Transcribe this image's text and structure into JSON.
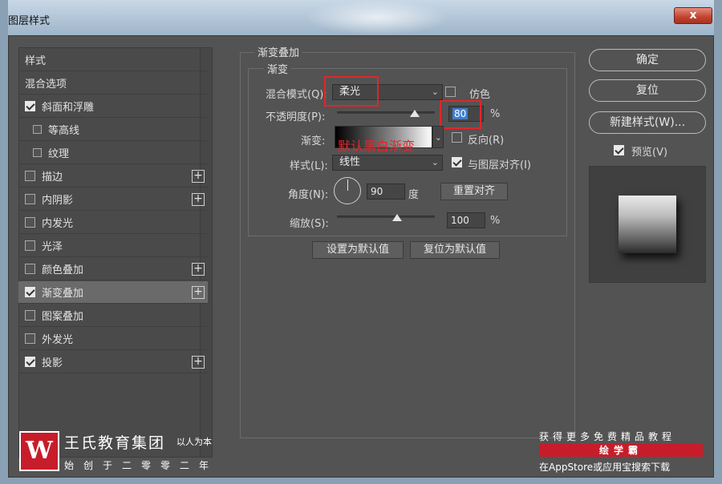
{
  "window": {
    "title": "图层样式",
    "close": "x"
  },
  "left_panel": {
    "items": [
      {
        "label": "样式",
        "checkbox": false,
        "checked": false,
        "plus": false,
        "indent": false,
        "selected": false
      },
      {
        "label": "混合选项",
        "checkbox": false,
        "checked": false,
        "plus": false,
        "indent": false,
        "selected": false
      },
      {
        "label": "斜面和浮雕",
        "checkbox": true,
        "checked": true,
        "plus": false,
        "indent": false,
        "selected": false
      },
      {
        "label": "等高线",
        "checkbox": true,
        "checked": false,
        "plus": false,
        "indent": true,
        "selected": false
      },
      {
        "label": "纹理",
        "checkbox": true,
        "checked": false,
        "plus": false,
        "indent": true,
        "selected": false
      },
      {
        "label": "描边",
        "checkbox": true,
        "checked": false,
        "plus": true,
        "indent": false,
        "selected": false
      },
      {
        "label": "内阴影",
        "checkbox": true,
        "checked": false,
        "plus": true,
        "indent": false,
        "selected": false
      },
      {
        "label": "内发光",
        "checkbox": true,
        "checked": false,
        "plus": false,
        "indent": false,
        "selected": false
      },
      {
        "label": "光泽",
        "checkbox": true,
        "checked": false,
        "plus": false,
        "indent": false,
        "selected": false
      },
      {
        "label": "颜色叠加",
        "checkbox": true,
        "checked": false,
        "plus": true,
        "indent": false,
        "selected": false
      },
      {
        "label": "渐变叠加",
        "checkbox": true,
        "checked": true,
        "plus": true,
        "indent": false,
        "selected": true
      },
      {
        "label": "图案叠加",
        "checkbox": true,
        "checked": false,
        "plus": false,
        "indent": false,
        "selected": false
      },
      {
        "label": "外发光",
        "checkbox": true,
        "checked": false,
        "plus": false,
        "indent": false,
        "selected": false
      },
      {
        "label": "投影",
        "checkbox": true,
        "checked": true,
        "plus": true,
        "indent": false,
        "selected": false
      }
    ]
  },
  "gradient_overlay": {
    "section_title": "渐变叠加",
    "subsection_title": "渐变",
    "blend_mode_label": "混合模式(Q):",
    "blend_mode_value": "柔光",
    "dither_label": "仿色",
    "opacity_label": "不透明度(P):",
    "opacity_value": "80",
    "opacity_unit": "%",
    "gradient_label": "渐变:",
    "gradient_note": "默认黑白渐变",
    "reverse_label": "反向(R)",
    "style_label": "样式(L):",
    "style_value": "线性",
    "align_label": "与图层对齐(I)",
    "angle_label": "角度(N):",
    "angle_value": "90",
    "angle_unit": "度",
    "reset_align_label": "重置对齐",
    "scale_label": "缩放(S):",
    "scale_value": "100",
    "scale_unit": "%",
    "set_default_label": "设置为默认值",
    "reset_default_label": "复位为默认值"
  },
  "right_panel": {
    "ok_label": "确定",
    "reset_label": "复位",
    "new_style_label": "新建样式(W)...",
    "preview_label": "预览(V)"
  },
  "watermark": {
    "logo_text": "W",
    "company": "王氏教育集团",
    "slogan": "以人为本",
    "since": "始创于二零零二年",
    "right_line1": "获得更多免费精品教程",
    "right_line2": "绘学霸",
    "right_line3": "在AppStore或应用宝搜索下载"
  }
}
